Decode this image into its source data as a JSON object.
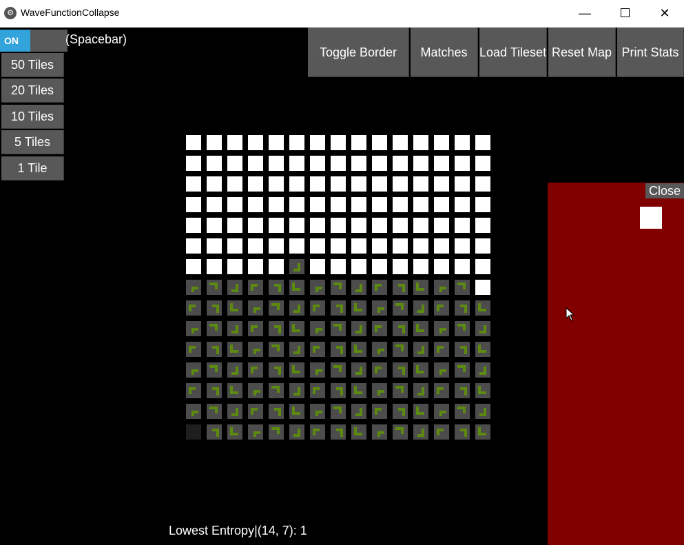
{
  "window": {
    "title": "WaveFunctionCollapse",
    "minimize_glyph": "—",
    "close_glyph": "✕",
    "app_icon_glyph": "⚙"
  },
  "toggle": {
    "state_label": "ON",
    "hint": "(Spacebar)",
    "on_color": "#33a3dc"
  },
  "left_buttons": [
    "50 Tiles",
    "20 Tiles",
    "10 Tiles",
    "5 Tiles",
    "1 Tile"
  ],
  "top_buttons": [
    "Toggle Border",
    "Matches",
    "Load Tileset",
    "Reset Map",
    "Print Stats"
  ],
  "grid": {
    "columns": 15,
    "rows": 15,
    "collapsed_rows_from": 7,
    "uncollapsed_color": "#ffffff",
    "tile_color": "#4c4c4c",
    "tile_pattern_color": "#5c8a0f",
    "extra_collapsed": [
      [
        5,
        6
      ]
    ],
    "extra_uncollapsed": [
      [
        14,
        7
      ]
    ],
    "dark_cells": [
      [
        0,
        14
      ]
    ]
  },
  "status": {
    "text": "Lowest Entropy|(14, 7): 1"
  },
  "popup": {
    "close_label": "Close",
    "background": "#800000",
    "swatch_color": "#ffffff"
  },
  "cursor": {
    "icon": "mouse-pointer-icon"
  }
}
